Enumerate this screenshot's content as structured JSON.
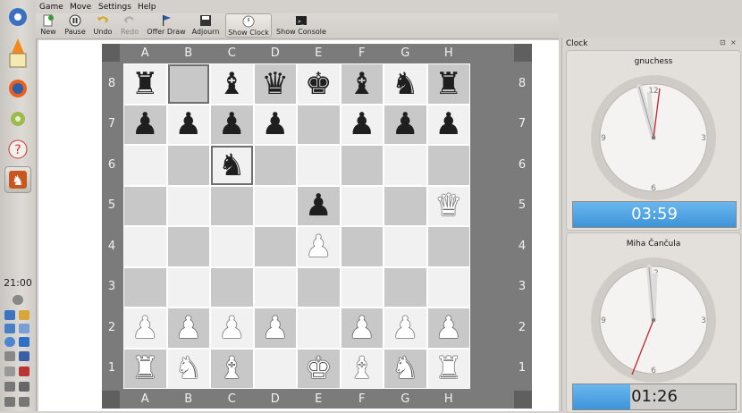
{
  "menu": [
    "Game",
    "Move",
    "Settings",
    "Help"
  ],
  "toolbar": [
    {
      "id": "new",
      "label": "New",
      "icon": "new-game-icon"
    },
    {
      "id": "pause",
      "label": "Pause",
      "icon": "pause-icon"
    },
    {
      "id": "undo",
      "label": "Undo",
      "icon": "undo-icon"
    },
    {
      "id": "redo",
      "label": "Redo",
      "icon": "redo-icon"
    },
    {
      "id": "offer-draw",
      "label": "Offer Draw",
      "icon": "flag-icon"
    },
    {
      "id": "adjourn",
      "label": "Adjourn",
      "icon": "save-icon"
    },
    {
      "id": "show-clock",
      "label": "Show Clock",
      "icon": "clock-icon",
      "pressed": true
    },
    {
      "id": "show-console",
      "label": "Show Console",
      "icon": "console-icon"
    }
  ],
  "board": {
    "files": [
      "A",
      "B",
      "C",
      "D",
      "E",
      "F",
      "G",
      "H"
    ],
    "ranks": [
      "8",
      "7",
      "6",
      "5",
      "4",
      "3",
      "2",
      "1"
    ],
    "position": [
      [
        "bR",
        "",
        "bB",
        "bQ",
        "bK",
        "bB",
        "bN",
        "bR"
      ],
      [
        "bP",
        "bP",
        "bP",
        "bP",
        "",
        "bP",
        "bP",
        "bP"
      ],
      [
        "",
        "",
        "bN",
        "",
        "",
        "",
        "",
        ""
      ],
      [
        "",
        "",
        "",
        "",
        "bP",
        "",
        "",
        "wQ"
      ],
      [
        "",
        "",
        "",
        "",
        "wP",
        "",
        "",
        ""
      ],
      [
        "",
        "",
        "",
        "",
        "",
        "",
        "",
        ""
      ],
      [
        "wP",
        "wP",
        "wP",
        "wP",
        "",
        "wP",
        "wP",
        "wP"
      ],
      [
        "wR",
        "wN",
        "wB",
        "",
        "wK",
        "wB",
        "wN",
        "wR"
      ]
    ],
    "highlighted": [
      "b8",
      "c6"
    ]
  },
  "taskbar": {
    "time": "21:00"
  },
  "clock": {
    "title": "Clock",
    "players": [
      {
        "name": "gnuchess",
        "time": "03:59",
        "progress": 1.0,
        "active": true
      },
      {
        "name": "Miha Čančula",
        "time": "01:26",
        "progress": 0.35,
        "active": false
      }
    ]
  },
  "colors": {
    "dark_square": "#c8c8c8",
    "light_square": "#f1f1f1",
    "frame": "#7b7b7b",
    "clock_fill": "#4ca3e3"
  }
}
